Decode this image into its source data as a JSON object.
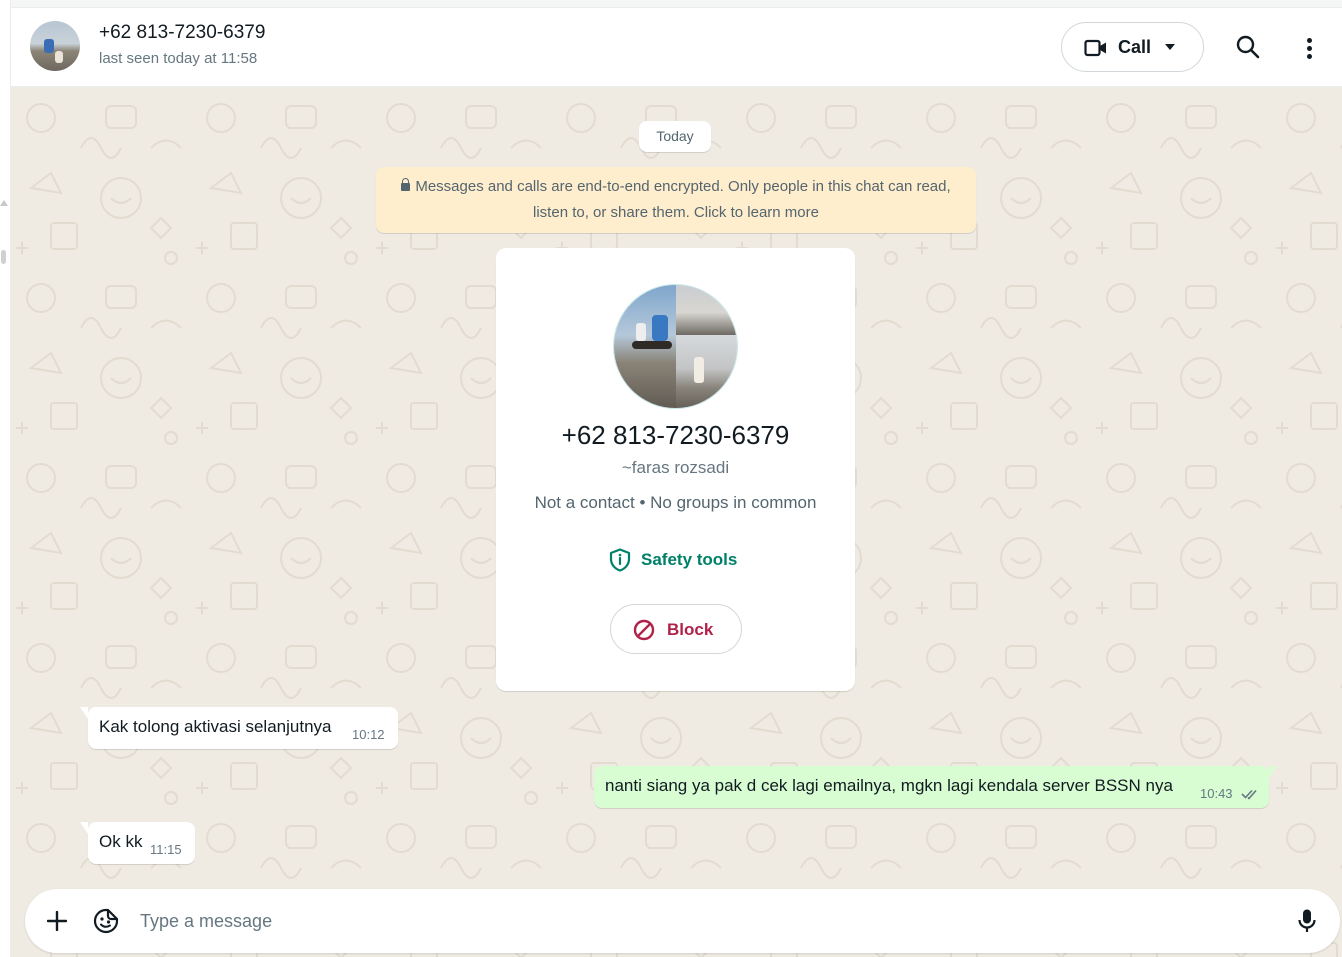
{
  "header": {
    "contact_name": "+62 813-7230-6379",
    "status": "last seen today at 11:58",
    "call_label": "Call"
  },
  "chat": {
    "date_divider": "Today",
    "encryption_notice": "Messages and calls are end-to-end encrypted. Only people in this chat can read, listen to, or share them. Click to learn more"
  },
  "contact_card": {
    "phone": "+62 813-7230-6379",
    "push_name": "~faras rozsadi",
    "meta": "Not a contact • No groups in common",
    "safety_tools_label": "Safety tools",
    "block_label": "Block"
  },
  "messages": [
    {
      "direction": "incoming",
      "text": "Kak tolong aktivasi selanjutnya",
      "time": "10:12"
    },
    {
      "direction": "outgoing",
      "text": "nanti siang ya pak d cek lagi emailnya, mgkn lagi kendala server BSSN nya",
      "time": "10:43",
      "status": "read"
    },
    {
      "direction": "incoming",
      "text": "Ok kk",
      "time": "11:15"
    }
  ],
  "composer": {
    "placeholder": "Type a message"
  },
  "colors": {
    "accent_green": "#008069",
    "block_red": "#b0224a",
    "outgoing_bubble": "#d9fdd3",
    "chat_background": "#efeae2",
    "encryption_bg": "#ffeecd",
    "read_tick": "#53bdeb"
  },
  "icons": [
    "video-camera-icon",
    "chevron-down-icon",
    "search-icon",
    "more-vertical-icon",
    "lock-icon",
    "shield-icon",
    "block-icon",
    "double-check-icon",
    "plus-icon",
    "sticker-icon",
    "microphone-icon"
  ]
}
